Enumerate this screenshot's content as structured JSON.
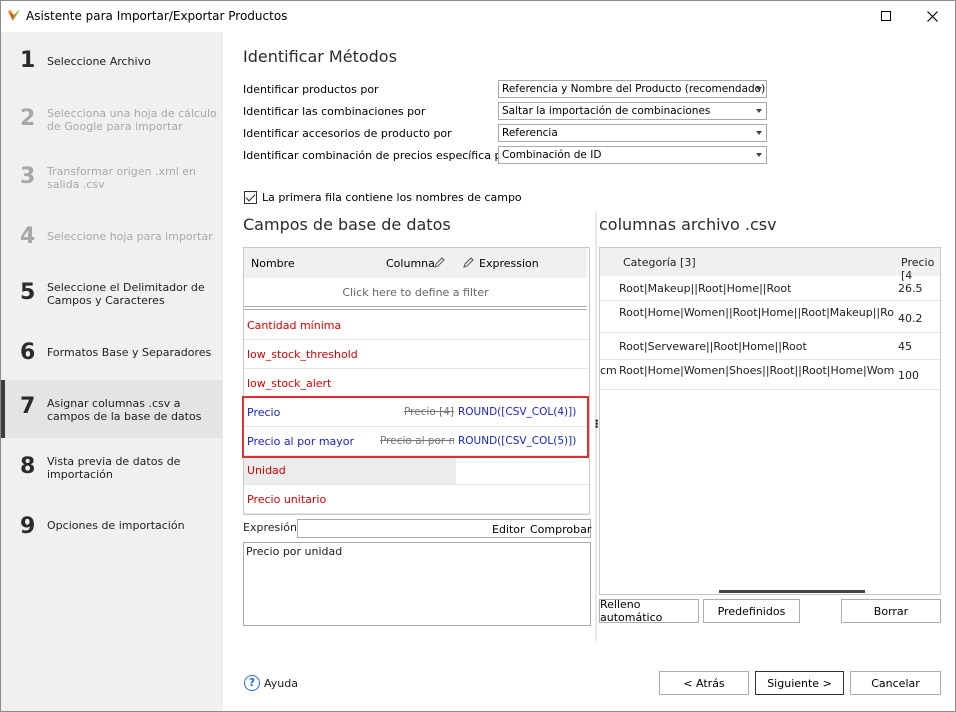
{
  "window": {
    "title": "Asistente para Importar/Exportar Productos",
    "icon": "app-logo-icon"
  },
  "steps": [
    {
      "num": "1",
      "label": "Seleccione Archivo"
    },
    {
      "num": "2",
      "label": "Selecciona una hoja de cálculo de Google para importar"
    },
    {
      "num": "3",
      "label": "Transformar origen .xml en salida .csv"
    },
    {
      "num": "4",
      "label": "Seleccione hoja para importar"
    },
    {
      "num": "5",
      "label": "Seleccione el Delimitador de Campos y Caracteres"
    },
    {
      "num": "6",
      "label": "Formatos Base y Separadores"
    },
    {
      "num": "7",
      "label": "Asignar columnas .csv a campos de la base de datos"
    },
    {
      "num": "8",
      "label": "Vista previa de datos de importación"
    },
    {
      "num": "9",
      "label": "Opciones de importación"
    }
  ],
  "identify": {
    "heading": "Identificar Métodos",
    "rows": [
      {
        "label": "Identificar productos por",
        "value": "Referencia y Nombre del Producto (recomendado)"
      },
      {
        "label": "Identificar las combinaciones por",
        "value": "Saltar la importación de combinaciones"
      },
      {
        "label": "Identificar accesorios de producto por",
        "value": "Referencia"
      },
      {
        "label": "Identificar combinación de precios específica por",
        "value": "Combinación de ID"
      }
    ]
  },
  "first_row_checkbox": {
    "label": "La primera fila contiene los nombres de campo",
    "checked": true
  },
  "db_fields": {
    "heading": "Campos de base de datos",
    "columns": {
      "name": "Nombre",
      "column": "Columna",
      "expression": "Expression"
    },
    "filter_placeholder": "Click here to define a filter",
    "rows": [
      {
        "name": "Cantidad mínima",
        "column": "",
        "expression": ""
      },
      {
        "name": "low_stock_threshold",
        "column": "",
        "expression": ""
      },
      {
        "name": "low_stock_alert",
        "column": "",
        "expression": ""
      },
      {
        "name": "Precio",
        "column": "Precio [4]",
        "expression": "ROUND([CSV_COL(4)])"
      },
      {
        "name": "Precio al por mayor",
        "column": "Precio al por mayor",
        "expression": "ROUND([CSV_COL(5)])"
      },
      {
        "name": "Unidad",
        "column": "",
        "expression": ""
      },
      {
        "name": "Precio unitario",
        "column": "",
        "expression": ""
      }
    ]
  },
  "expression_bar": {
    "label": "Expresión",
    "editor": "Editor",
    "check": "Comprobar",
    "text": "Precio por unidad"
  },
  "csv_columns": {
    "heading": "columnas archivo .csv",
    "columns": {
      "category": "Categoría [3]",
      "price": "Precio [4"
    },
    "rows": [
      {
        "lead": "",
        "category": "Root|Makeup||Root|Home||Root",
        "price": "26.5"
      },
      {
        "lead": "",
        "category": "Root|Home|Women||Root|Home||Root|Makeup||Root",
        "price": "40.2"
      },
      {
        "lead": "",
        "category": "Root|Serveware||Root|Home||Root",
        "price": "45"
      },
      {
        "lead": "cm",
        "category": "Root|Home|Women|Shoes||Root||Root|Home|Women",
        "price": "100"
      }
    ]
  },
  "csv_buttons": {
    "autofill": "Relleno automático",
    "predefined": "Predefinidos",
    "delete": "Borrar"
  },
  "footer": {
    "help": "Ayuda",
    "back": "< Atrás",
    "next": "Siguiente >",
    "cancel": "Cancelar"
  }
}
